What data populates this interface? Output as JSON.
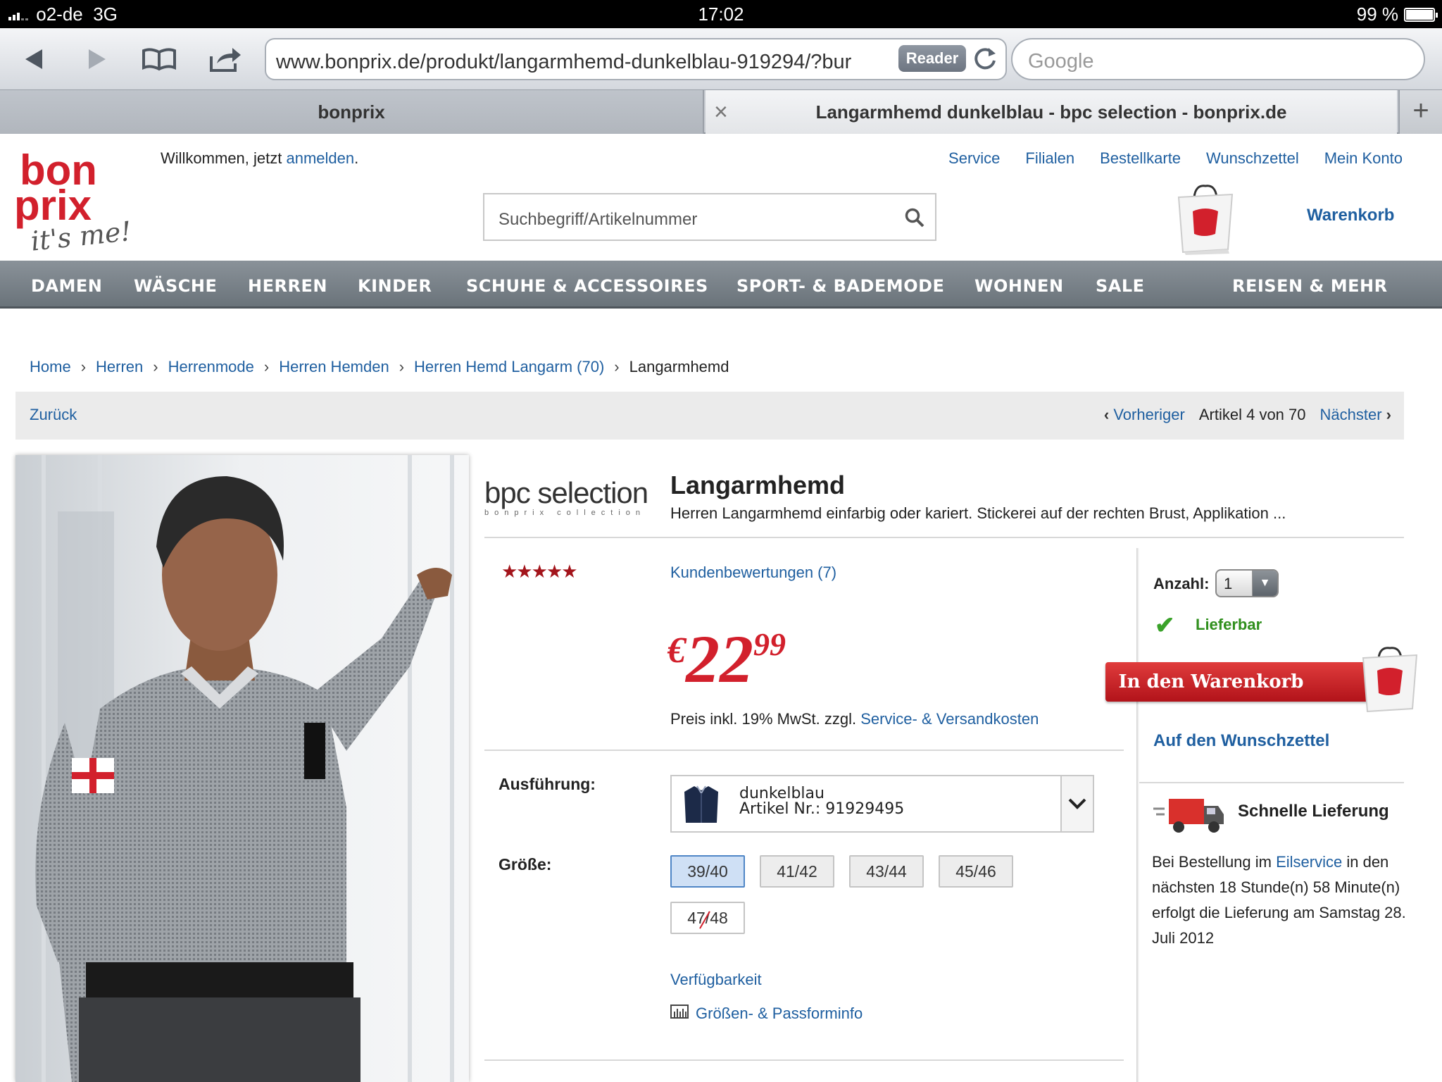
{
  "status": {
    "carrier": "o2-de",
    "network": "3G",
    "time": "17:02",
    "battery": "99 %"
  },
  "browser": {
    "url": "www.bonprix.de/produkt/langarmhemd-dunkelblau-919294/?bur",
    "reader_label": "Reader",
    "search_placeholder": "Google",
    "tabs": [
      {
        "title": "bonprix"
      },
      {
        "title": "Langarmhemd dunkelblau - bpc selection - bonprix.de"
      }
    ],
    "close_tab": "×",
    "add_tab": "+"
  },
  "header": {
    "logo_text": [
      "bon",
      "prix",
      "it's me!"
    ],
    "welcome_prefix": "Willkommen, jetzt ",
    "welcome_link": "anmelden",
    "welcome_suffix": ".",
    "top_links": [
      "Service",
      "Filialen",
      "Bestellkarte",
      "Wunschzettel",
      "Mein Konto"
    ],
    "search_placeholder": "Suchbegriff/Artikelnummer",
    "cart_label": "Warenkorb"
  },
  "nav": [
    "DAMEN",
    "WÄSCHE",
    "HERREN",
    "KINDER",
    "SCHUHE & ACCESSOIRES",
    "SPORT- & BADEMODE",
    "WOHNEN",
    "SALE",
    "REISEN & MEHR"
  ],
  "breadcrumb": [
    "Home",
    "Herren",
    "Herrenmode",
    "Herren Hemden",
    "Herren Hemd Langarm (70)",
    "Langarmhemd"
  ],
  "pager": {
    "back": "Zurück",
    "prev": "Vorheriger",
    "position": "Artikel 4 von 70",
    "next": "Nächster"
  },
  "product": {
    "brand": "bpc selection",
    "brand_sub": "bonprix collection",
    "title": "Langarmhemd",
    "description": "Herren Langarmhemd einfarbig oder kariert. Stickerei auf der rechten Brust, Applikation ...",
    "rating_stars": "★★★★★",
    "rating": 5,
    "reviews_label": "Kundenbewertungen (7)",
    "price_currency": "€",
    "price_int": "22",
    "price_dec": "99",
    "price_info": "Preis inkl. 19% MwSt. zzgl. ",
    "price_info_link": "Service- & Versandkosten",
    "variant_label": "Ausführung:",
    "variant_name": "dunkelblau",
    "variant_article": "Artikel Nr.: 91929495",
    "size_label": "Größe:",
    "sizes": [
      {
        "label": "39/40",
        "selected": true,
        "available": true
      },
      {
        "label": "41/42",
        "selected": false,
        "available": true
      },
      {
        "label": "43/44",
        "selected": false,
        "available": true
      },
      {
        "label": "45/46",
        "selected": false,
        "available": true
      },
      {
        "label": "47/48",
        "selected": false,
        "available": false
      }
    ],
    "availability_link": "Verfügbarkeit",
    "size_info_link": "Größen- & Passforminfo"
  },
  "buy": {
    "qty_label": "Anzahl:",
    "qty_value": "1",
    "stock_status": "Lieferbar",
    "cart_button": "In den Warenkorb",
    "wishlist": "Auf den Wunschzettel",
    "fast_title": "Schnelle Lieferung",
    "fast_text_1": "Bei Bestellung im ",
    "fast_link": "Eilservice",
    "fast_text_2": " in den nächsten 18 Stunde(n) 58 Minute(n) erfolgt die Lieferung am Samstag 28. Juli 2012"
  },
  "colors": {
    "brand_red": "#d2202c",
    "link_blue": "#1f5fa0",
    "nav_gray": "#6a737a",
    "stock_green": "#2f8f1c"
  }
}
